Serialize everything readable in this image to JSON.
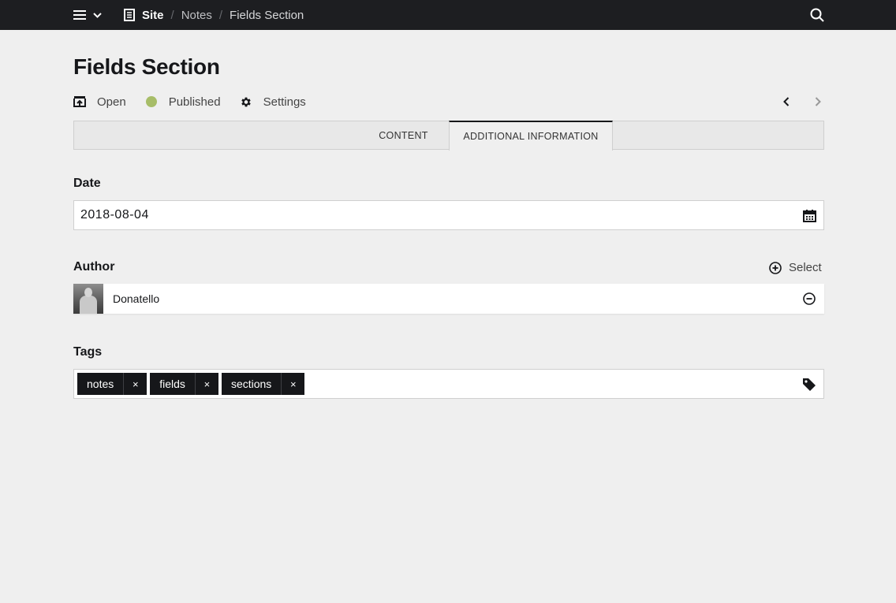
{
  "breadcrumb": {
    "site": "Site",
    "items": [
      "Notes",
      "Fields Section"
    ]
  },
  "page": {
    "title": "Fields Section",
    "options": {
      "open": "Open",
      "status": "Published",
      "status_color": "#a7bd68",
      "settings": "Settings"
    }
  },
  "tabs": [
    {
      "label": "CONTENT",
      "active": false
    },
    {
      "label": "ADDITIONAL INFORMATION",
      "active": true
    }
  ],
  "fields": {
    "date": {
      "label": "Date",
      "value": "2018-08-04",
      "icon": "calendar-icon"
    },
    "author": {
      "label": "Author",
      "select_label": "Select",
      "item": {
        "name": "Donatello"
      }
    },
    "tags": {
      "label": "Tags",
      "items": [
        "notes",
        "fields",
        "sections"
      ],
      "remove_glyph": "×",
      "icon": "tag-icon"
    }
  },
  "colors": {
    "topbar": "#1d1e21",
    "background": "#efefef",
    "tag": "#16171a"
  }
}
